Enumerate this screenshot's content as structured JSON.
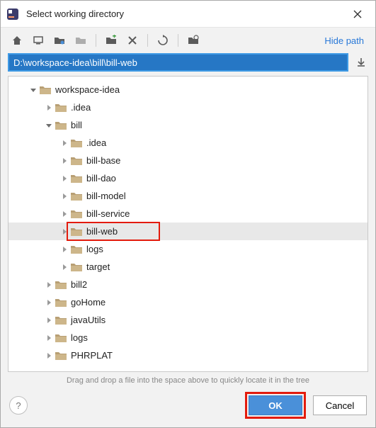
{
  "title": "Select working directory",
  "hide_path_label": "Hide path",
  "path_value": "D:\\workspace-idea\\bill\\bill-web",
  "hint": "Drag and drop a file into the space above to quickly locate it in the tree",
  "buttons": {
    "ok": "OK",
    "cancel": "Cancel",
    "help": "?"
  },
  "icons": {
    "home": "home-icon",
    "desktop": "desktop-icon",
    "project": "project-icon",
    "module": "module-icon",
    "newfolder": "new-folder-icon",
    "delete": "delete-icon",
    "refresh": "refresh-icon",
    "showhidden": "show-hidden-icon",
    "download": "download-icon"
  },
  "tree": [
    {
      "depth": 0,
      "expander": "open",
      "label": "workspace-idea",
      "selected": false
    },
    {
      "depth": 1,
      "expander": "closed",
      "label": ".idea",
      "selected": false
    },
    {
      "depth": 1,
      "expander": "open",
      "label": "bill",
      "selected": false
    },
    {
      "depth": 2,
      "expander": "closed",
      "label": ".idea",
      "selected": false
    },
    {
      "depth": 2,
      "expander": "closed",
      "label": "bill-base",
      "selected": false
    },
    {
      "depth": 2,
      "expander": "closed",
      "label": "bill-dao",
      "selected": false
    },
    {
      "depth": 2,
      "expander": "closed",
      "label": "bill-model",
      "selected": false
    },
    {
      "depth": 2,
      "expander": "closed",
      "label": "bill-service",
      "selected": false
    },
    {
      "depth": 2,
      "expander": "closed",
      "label": "bill-web",
      "selected": true
    },
    {
      "depth": 2,
      "expander": "closed",
      "label": "logs",
      "selected": false
    },
    {
      "depth": 2,
      "expander": "closed",
      "label": "target",
      "selected": false
    },
    {
      "depth": 1,
      "expander": "closed",
      "label": "bill2",
      "selected": false
    },
    {
      "depth": 1,
      "expander": "closed",
      "label": "goHome",
      "selected": false
    },
    {
      "depth": 1,
      "expander": "closed",
      "label": "javaUtils",
      "selected": false
    },
    {
      "depth": 1,
      "expander": "closed",
      "label": "logs",
      "selected": false
    },
    {
      "depth": 1,
      "expander": "closed",
      "label": "PHRPLAT",
      "selected": false
    }
  ],
  "colors": {
    "accent": "#4a90d9",
    "highlight": "#e31b0c",
    "link": "#2878d8"
  }
}
